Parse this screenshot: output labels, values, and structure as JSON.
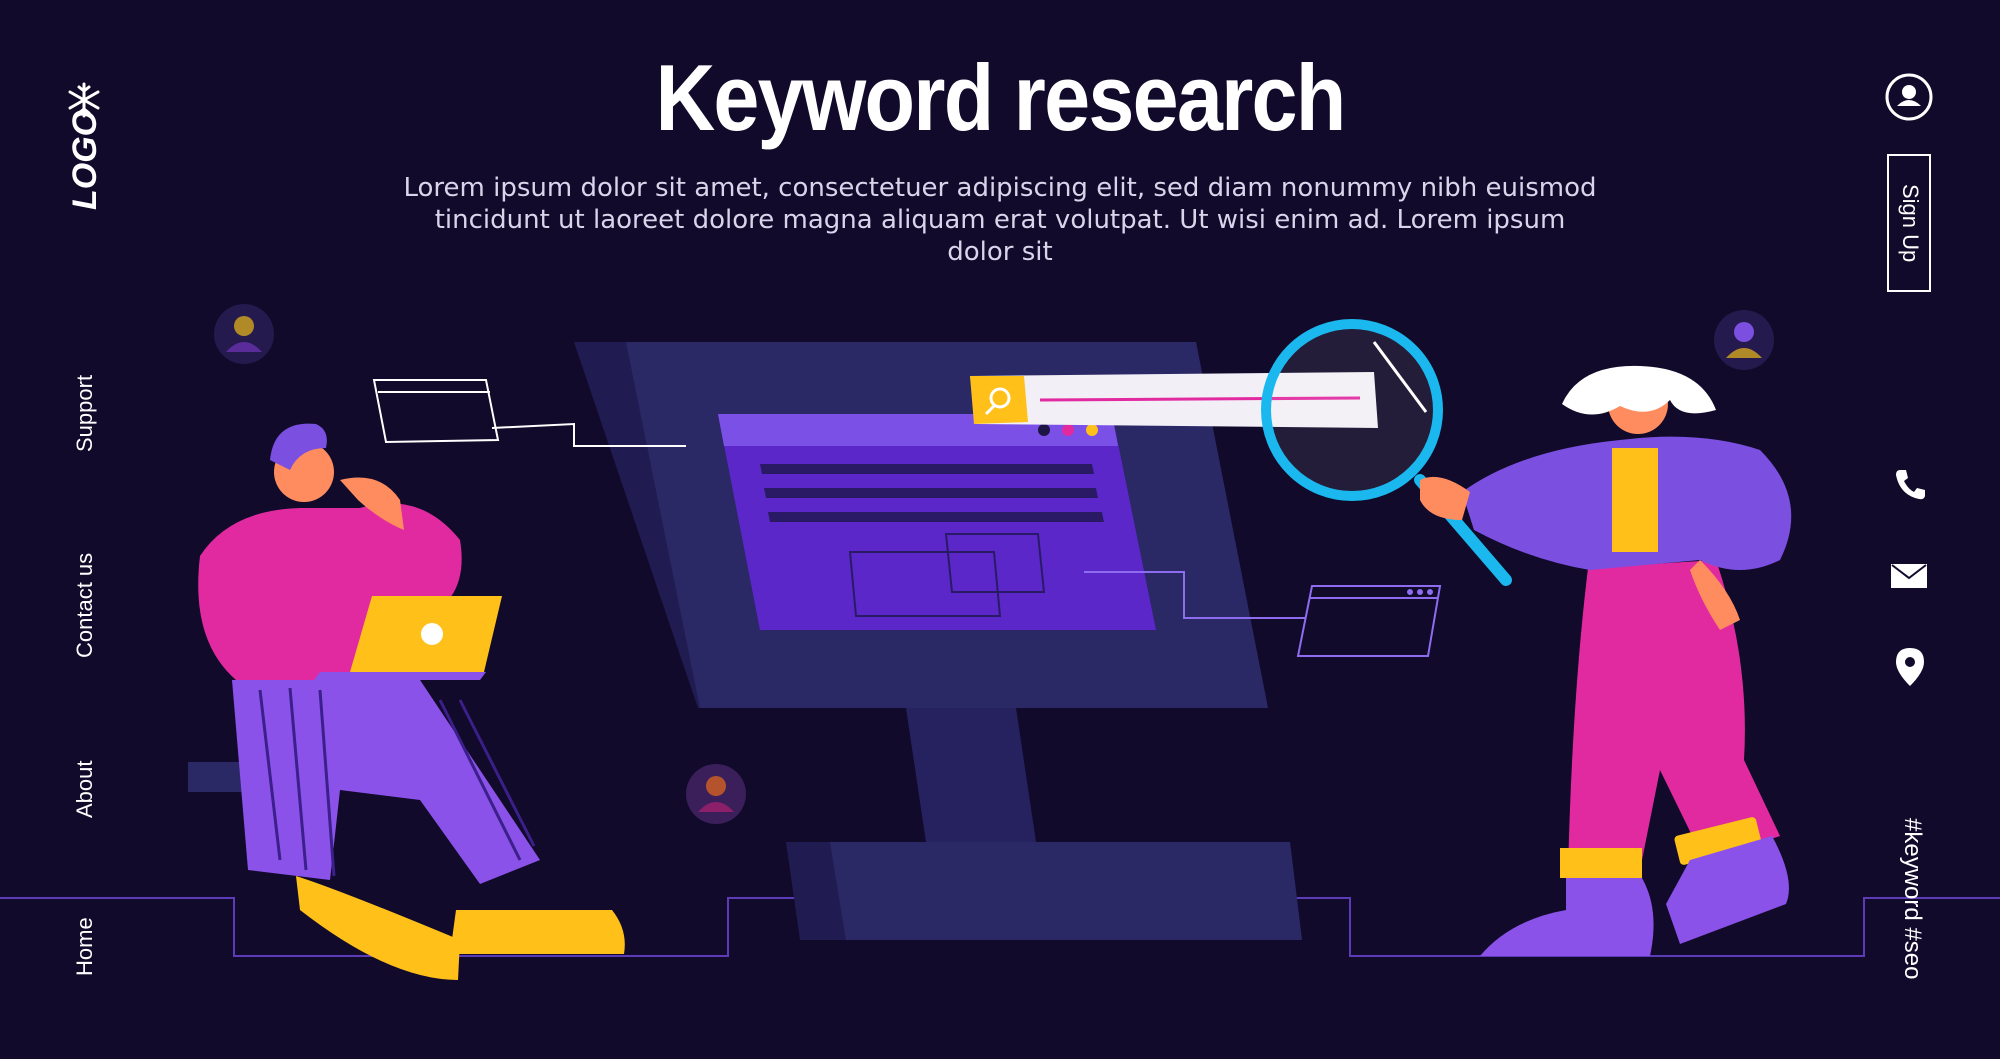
{
  "header": {
    "title": "Keyword research",
    "subtitle_line1": "Lorem ipsum dolor sit amet, consectetuer adipiscing elit, sed diam nonummy nibh euismod",
    "subtitle_line2": "tincidunt ut laoreet dolore magna aliquam erat volutpat. Ut wisi enim ad. Lorem ipsum dolor sit"
  },
  "logo": {
    "text": "LOGO",
    "icon": "snowflake-icon"
  },
  "left_nav": {
    "items": [
      {
        "label": "Support"
      },
      {
        "label": "Contact us"
      },
      {
        "label": "About"
      },
      {
        "label": "Home"
      }
    ]
  },
  "right_bar": {
    "signup_label": "Sign Up",
    "hashtags": "#keyword #seo",
    "icons": [
      "user-icon",
      "phone-icon",
      "mail-icon",
      "location-pin-icon"
    ]
  },
  "colors": {
    "background": "#110a2a",
    "purple": "#7b4fe0",
    "magenta": "#e22aa0",
    "yellow": "#ffc01a",
    "cyan": "#1bb8ef",
    "monitor": "#2b2866"
  }
}
